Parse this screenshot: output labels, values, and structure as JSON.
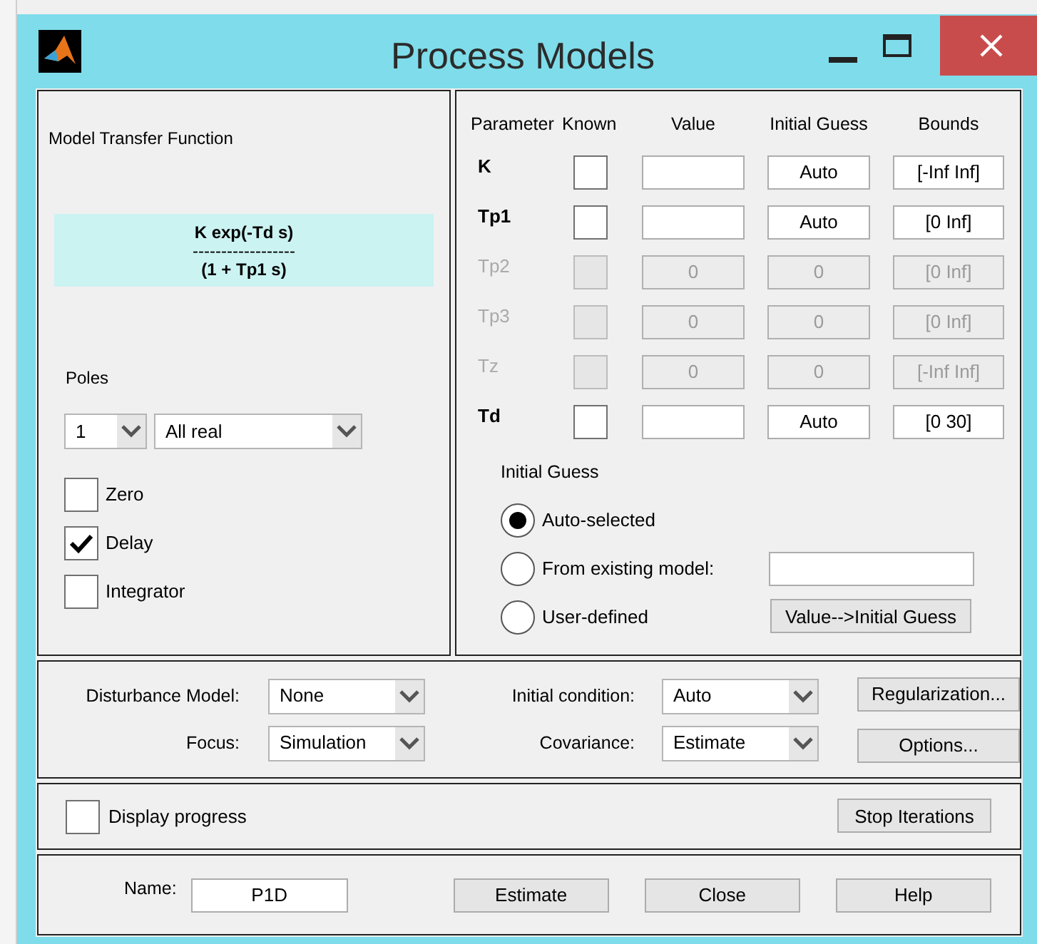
{
  "window": {
    "title": "Process Models"
  },
  "model_panel": {
    "title": "Model Transfer Function",
    "numerator": "K exp(-Td s)",
    "divider": "------------------",
    "denominator": "(1 + Tp1 s)",
    "poles_label": "Poles",
    "poles": {
      "value": "1"
    },
    "pole_type": {
      "value": "All real"
    },
    "options": [
      {
        "label": "Zero",
        "checked": false
      },
      {
        "label": "Delay",
        "checked": true
      },
      {
        "label": "Integrator",
        "checked": false
      }
    ]
  },
  "parameters": {
    "columns": [
      "Parameter",
      "Known",
      "Value",
      "Initial Guess",
      "Bounds"
    ],
    "rows": [
      {
        "name": "K",
        "known": false,
        "value": "",
        "initial_guess": "Auto",
        "bounds": "[-Inf Inf]",
        "disabled": false
      },
      {
        "name": "Tp1",
        "known": false,
        "value": "",
        "initial_guess": "Auto",
        "bounds": "[0 Inf]",
        "disabled": false
      },
      {
        "name": "Tp2",
        "known": false,
        "value": "0",
        "initial_guess": "0",
        "bounds": "[0 Inf]",
        "disabled": true
      },
      {
        "name": "Tp3",
        "known": false,
        "value": "0",
        "initial_guess": "0",
        "bounds": "[0 Inf]",
        "disabled": true
      },
      {
        "name": "Tz",
        "known": false,
        "value": "0",
        "initial_guess": "0",
        "bounds": "[-Inf Inf]",
        "disabled": true
      },
      {
        "name": "Td",
        "known": false,
        "value": "",
        "initial_guess": "Auto",
        "bounds": "[0 30]",
        "disabled": false
      }
    ]
  },
  "initial_guess": {
    "title": "Initial Guess",
    "options": [
      {
        "label": "Auto-selected",
        "selected": true
      },
      {
        "label": "From existing model:",
        "selected": false
      },
      {
        "label": "User-defined",
        "selected": false
      }
    ],
    "button": "Value-->Initial Guess"
  },
  "settings": {
    "disturbance_model": {
      "label": "Disturbance Model:",
      "value": "None"
    },
    "focus": {
      "label": "Focus:",
      "value": "Simulation"
    },
    "initial_condition": {
      "label": "Initial condition:",
      "value": "Auto"
    },
    "covariance": {
      "label": "Covariance:",
      "value": "Estimate"
    },
    "buttons": [
      "Regularization...",
      "Options..."
    ]
  },
  "progress": {
    "label": "Display progress",
    "checked": false,
    "button": "Stop Iterations"
  },
  "footer": {
    "name_label": "Name:",
    "name_value": "P1D",
    "buttons": [
      "Estimate",
      "Close",
      "Help"
    ]
  }
}
